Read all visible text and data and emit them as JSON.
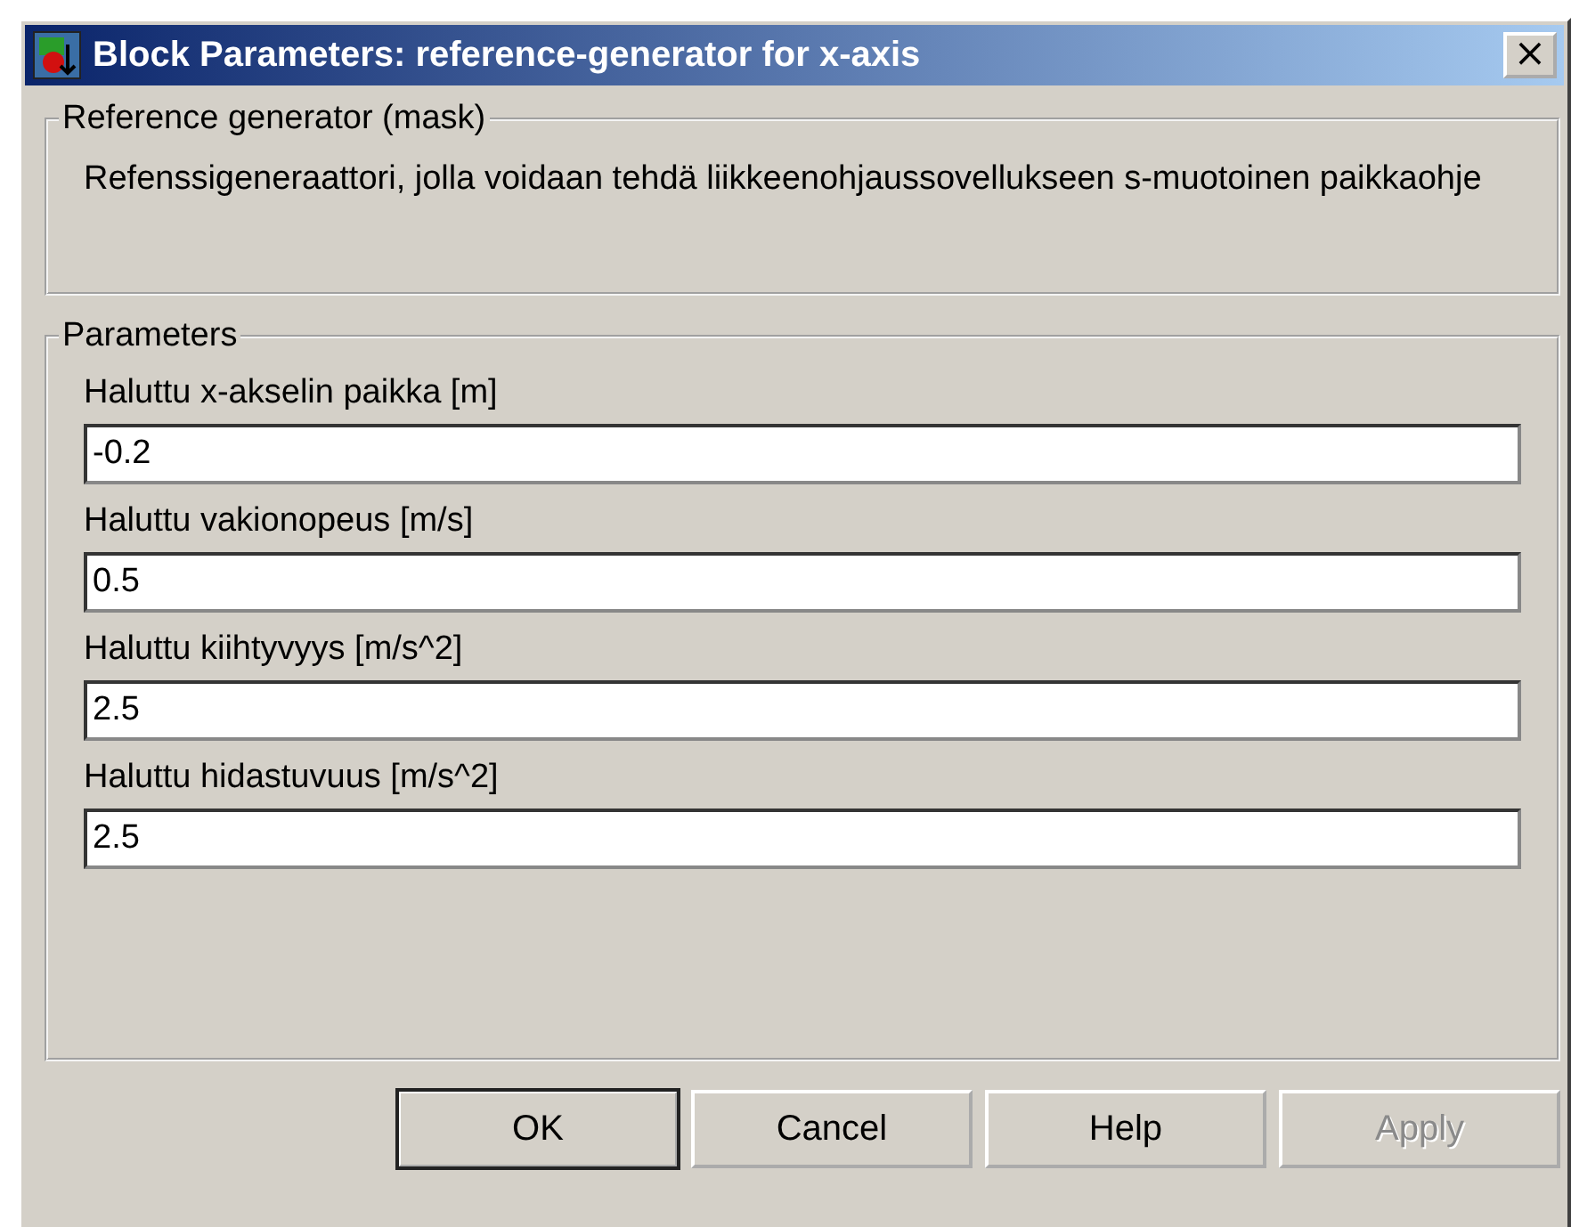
{
  "window": {
    "title": "Block Parameters: reference-generator for x-axis",
    "close": "×"
  },
  "description_group": {
    "legend": "Reference generator (mask)",
    "text": "Refenssigeneraattori, jolla voidaan tehdä liikkeenohjaussovellukseen s-muotoinen paikkaohje"
  },
  "parameters_group": {
    "legend": "Parameters",
    "fields": [
      {
        "label": "Haluttu x-akselin paikka [m]",
        "value": "-0.2"
      },
      {
        "label": "Haluttu vakionopeus [m/s]",
        "value": "0.5"
      },
      {
        "label": "Haluttu kiihtyvyys [m/s^2]",
        "value": "2.5"
      },
      {
        "label": "Haluttu hidastuvuus [m/s^2]",
        "value": "2.5"
      }
    ]
  },
  "buttons": [
    {
      "label": "OK",
      "default": true,
      "disabled": false
    },
    {
      "label": "Cancel",
      "default": false,
      "disabled": false
    },
    {
      "label": "Help",
      "default": false,
      "disabled": false
    },
    {
      "label": "Apply",
      "default": false,
      "disabled": true
    }
  ]
}
